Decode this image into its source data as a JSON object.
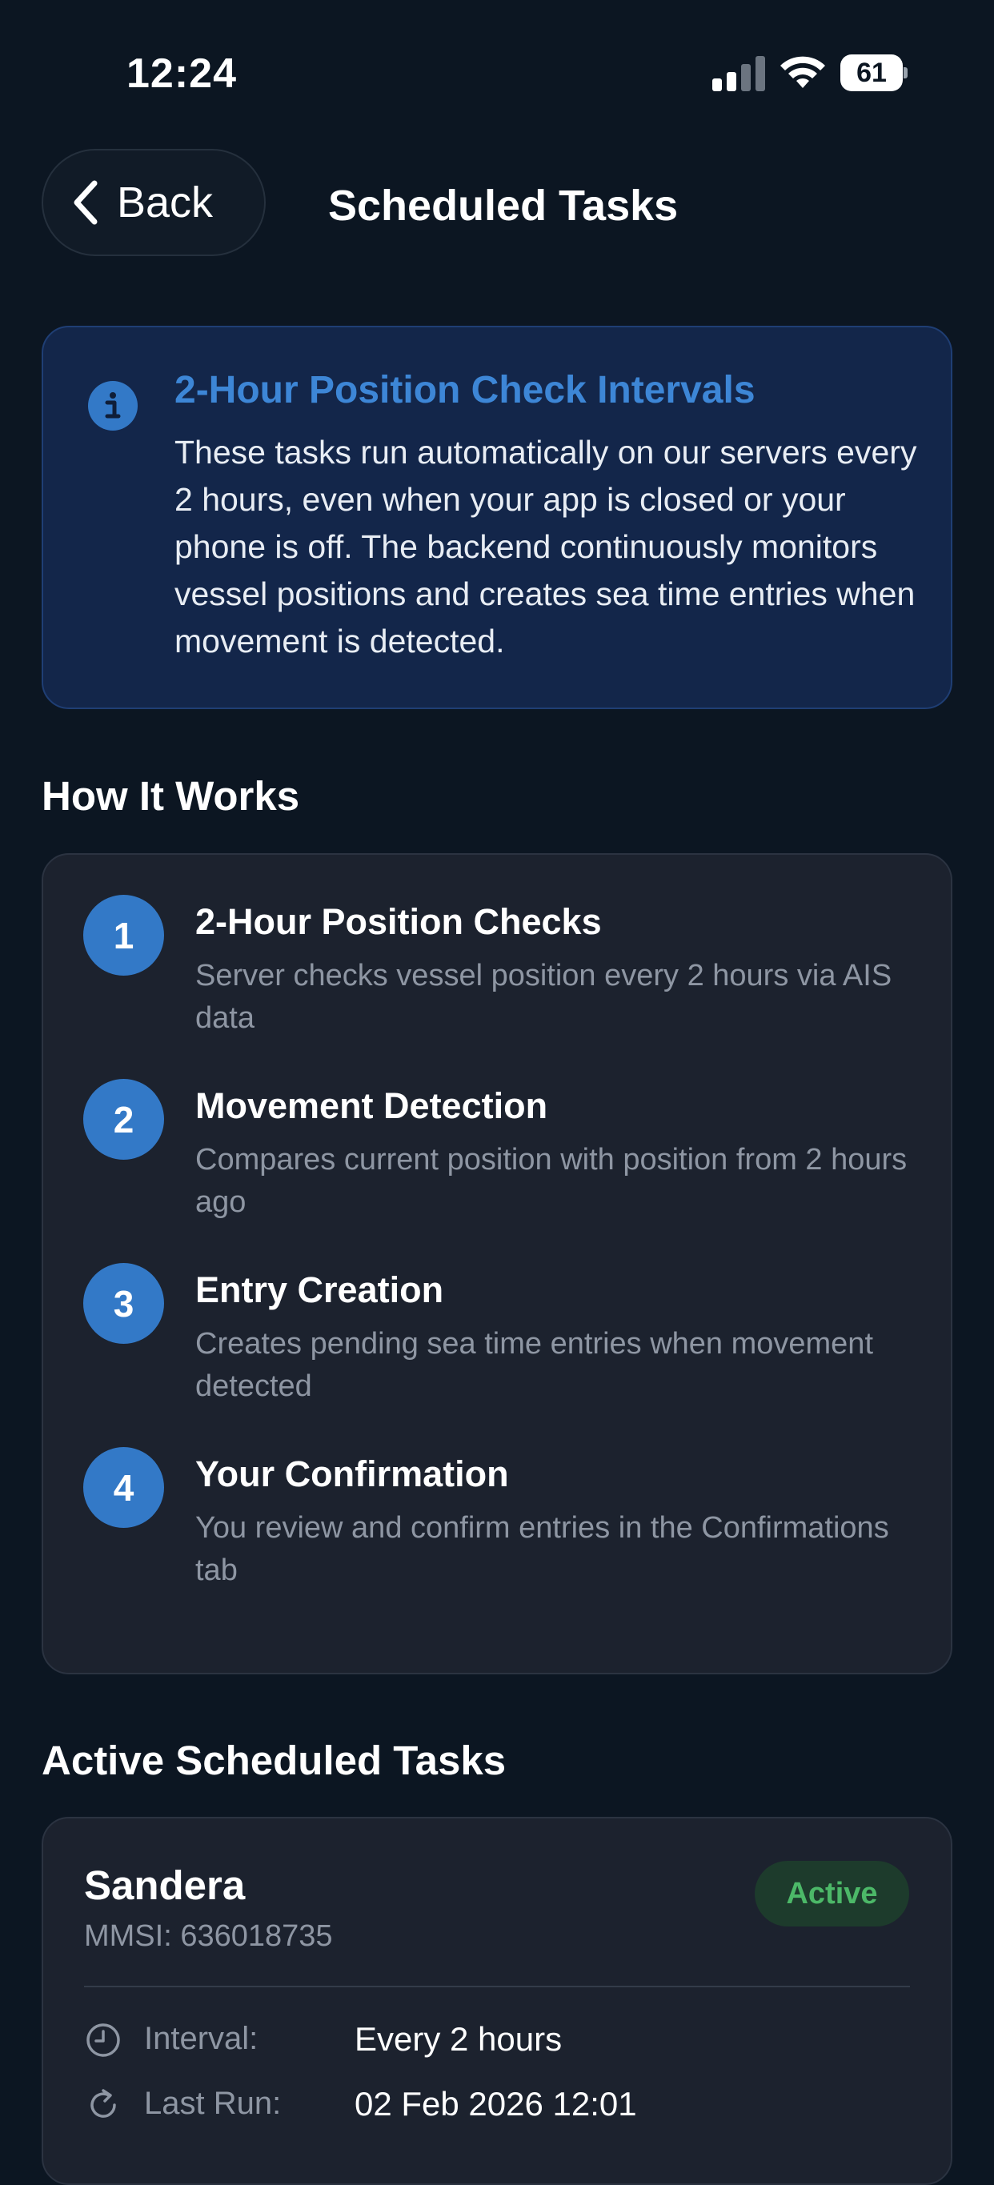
{
  "status_bar": {
    "time": "12:24",
    "battery": "61"
  },
  "header": {
    "back_label": "Back",
    "title": "Scheduled Tasks"
  },
  "info": {
    "title": "2-Hour Position Check Intervals",
    "body": "These tasks run automatically on our servers every 2 hours, even when your app is closed or your phone is off. The backend continuously monitors vessel positions and creates sea time entries when movement is detected."
  },
  "how_it_works": {
    "title": "How It Works",
    "steps": [
      {
        "number": "1",
        "title": "2-Hour Position Checks",
        "desc": "Server checks vessel position every 2 hours via AIS data"
      },
      {
        "number": "2",
        "title": "Movement Detection",
        "desc": "Compares current position with position from 2 hours ago"
      },
      {
        "number": "3",
        "title": "Entry Creation",
        "desc": "Creates pending sea time entries when movement detected"
      },
      {
        "number": "4",
        "title": "Your Confirmation",
        "desc": "You review and confirm entries in the Confirmations tab"
      }
    ]
  },
  "active_tasks": {
    "title": "Active Scheduled Tasks",
    "task": {
      "vessel": "Sandera",
      "mmsi": "MMSI: 636018735",
      "status": "Active",
      "interval_label": "Interval:",
      "interval_value": "Every 2 hours",
      "last_run_label": "Last Run:",
      "last_run_value": "02 Feb 2026 12:01"
    }
  },
  "colors": {
    "background": "#0c1622",
    "accent": "#3379c7",
    "info_title": "#3d86d6",
    "active_badge_text": "#4cb868"
  }
}
